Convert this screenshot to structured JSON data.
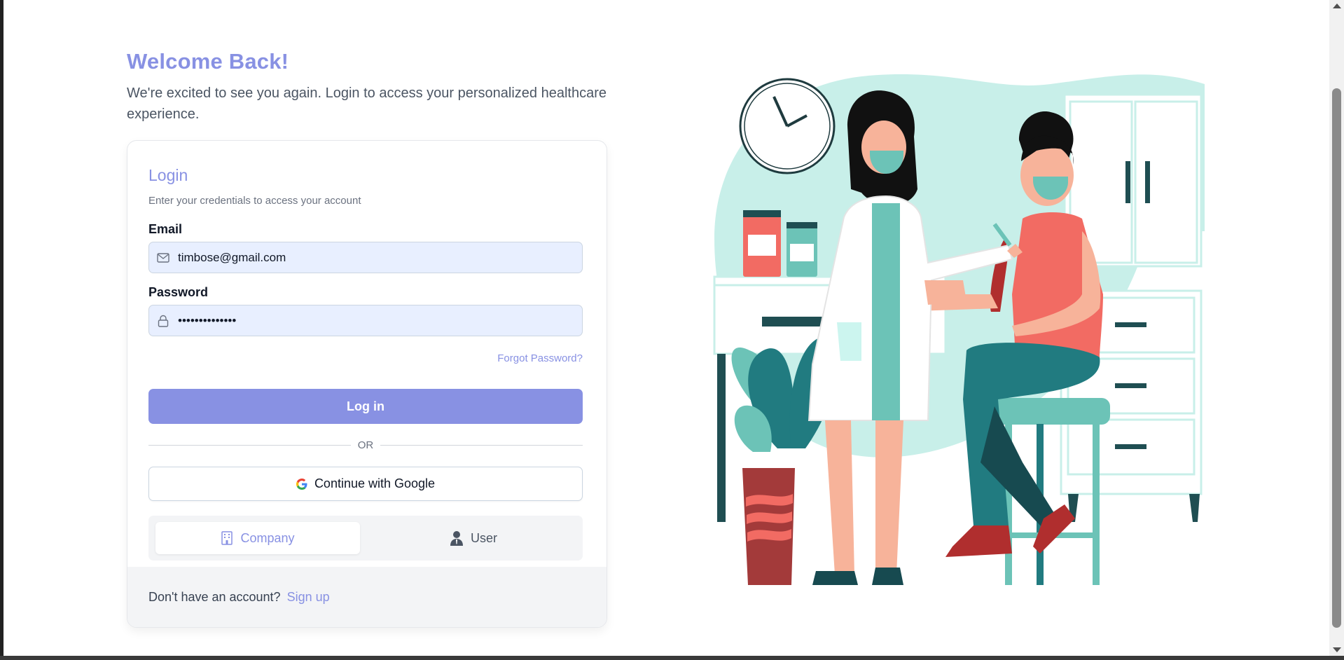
{
  "header": {
    "welcome": "Welcome Back!",
    "subtitle": "We're excited to see you again. Login to access your personalized healthcare experience."
  },
  "card": {
    "title": "Login",
    "description": "Enter your credentials to access your account",
    "email": {
      "label": "Email",
      "value": "timbose@gmail.com",
      "icon": "mail-icon"
    },
    "password": {
      "label": "Password",
      "value": "••••••••••••••",
      "icon": "lock-icon"
    },
    "forgot_label": "Forgot Password?",
    "login_label": "Log in",
    "divider_label": "OR",
    "google_label": "Continue with Google",
    "roles": [
      {
        "label": "Company",
        "icon": "building-icon",
        "active": true
      },
      {
        "label": "User",
        "icon": "user-icon",
        "active": false
      }
    ],
    "footer": {
      "question": "Don't have an account?",
      "signup_label": "Sign up"
    }
  },
  "colors": {
    "accent": "#8891e3",
    "input_bg": "#e8efff",
    "illustration_teal": "#c8efe9",
    "shirt": "#f26b63",
    "pants": "#217b80"
  }
}
